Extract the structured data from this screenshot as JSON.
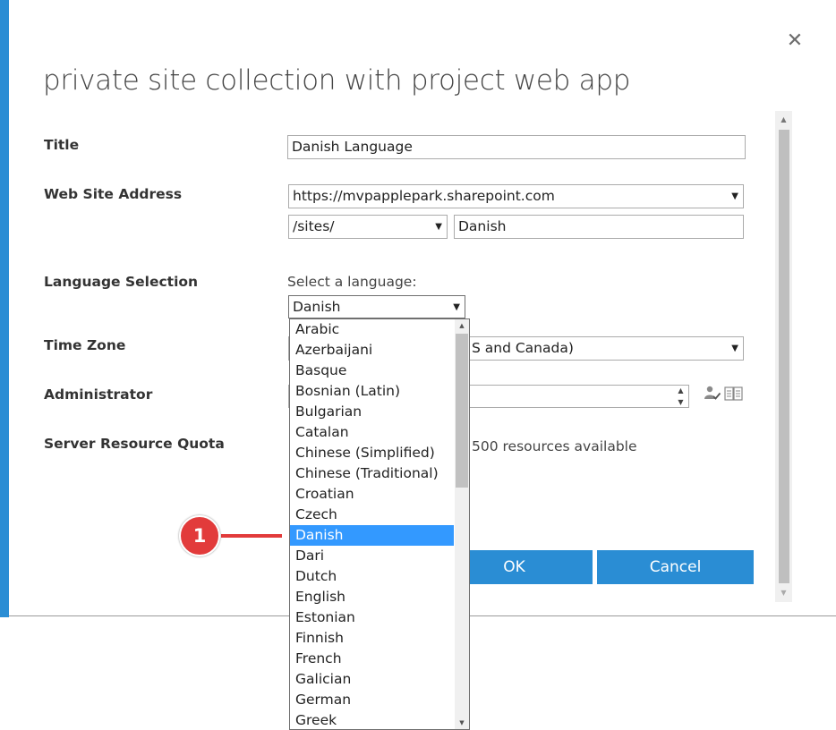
{
  "dialog": {
    "title": "private site collection with project web app",
    "close_icon": "close-icon",
    "close_symbol": "✕"
  },
  "form": {
    "title": {
      "label": "Title",
      "value": "Danish Language"
    },
    "web_site_address": {
      "label": "Web Site Address",
      "url_value": "https://mvpapplepark.sharepoint.com",
      "path_value": "/sites/",
      "site_name_value": "Danish"
    },
    "language_selection": {
      "label": "Language Selection",
      "hint": "Select a language:",
      "selected_value": "Danish",
      "options": [
        "Arabic",
        "Azerbaijani",
        "Basque",
        "Bosnian (Latin)",
        "Bulgarian",
        "Catalan",
        "Chinese (Simplified)",
        "Chinese (Traditional)",
        "Croatian",
        "Czech",
        "Danish",
        "Dari",
        "Dutch",
        "English",
        "Estonian",
        "Finnish",
        "French",
        "Galician",
        "German",
        "Greek"
      ],
      "highlighted_option": "Danish"
    },
    "time_zone": {
      "label": "Time Zone",
      "visible_value": "S and Canada)"
    },
    "administrator": {
      "label": "Administrator",
      "value": ""
    },
    "server_resource_quota": {
      "label": "Server Resource Quota",
      "visible_text": "500 resources available"
    }
  },
  "buttons": {
    "ok_label": "OK",
    "cancel_label": "Cancel"
  },
  "callout": {
    "number": "1"
  },
  "colors": {
    "accent": "#2a8dd4",
    "selection": "#3399ff",
    "callout": "#e23b3b"
  },
  "icons": {
    "dropdown_arrow": "▼",
    "scroll_up": "▲",
    "scroll_down": "▼",
    "people_picker": "people-check-icon",
    "address_book": "address-book-icon"
  }
}
